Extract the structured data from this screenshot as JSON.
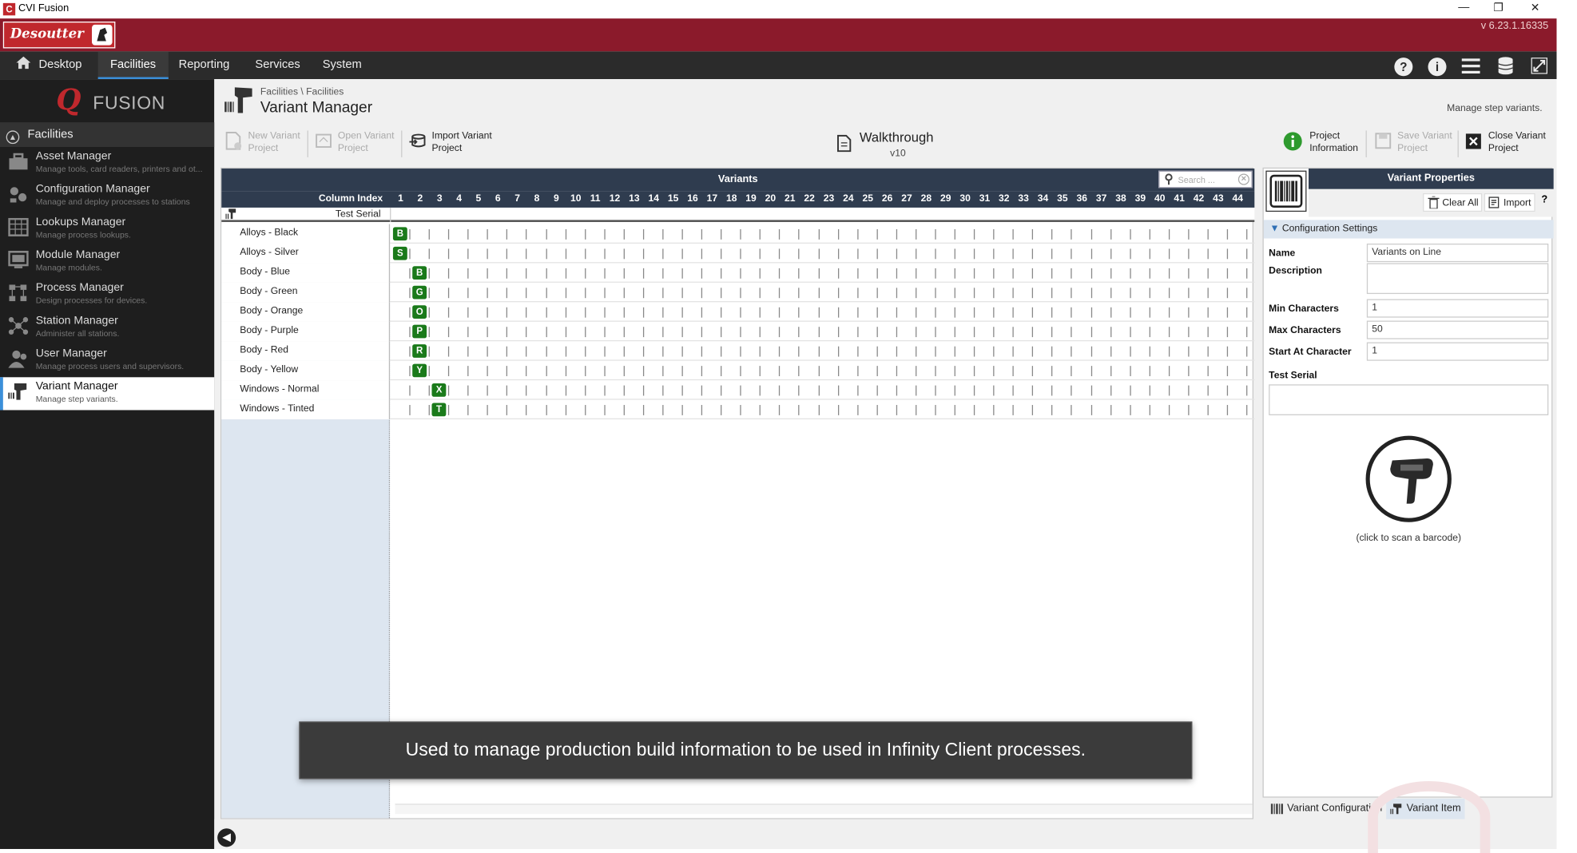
{
  "window": {
    "title": "CVI Fusion",
    "controls": [
      "—",
      "❐",
      "✕"
    ]
  },
  "brand": {
    "logo_text": "Desoutter",
    "version": "v 6.23.1.16335"
  },
  "menu": {
    "items": [
      "Desktop",
      "Facilities",
      "Reporting",
      "Services",
      "System"
    ],
    "active": "Facilities"
  },
  "sidebar": {
    "logo_text": "FUSION",
    "section": "Facilities",
    "items": [
      {
        "label": "Asset Manager",
        "sub": "Manage tools, card readers, printers and ot..."
      },
      {
        "label": "Configuration Manager",
        "sub": "Manage and deploy processes to stations"
      },
      {
        "label": "Lookups Manager",
        "sub": "Manage process lookups."
      },
      {
        "label": "Module Manager",
        "sub": "Manage modules."
      },
      {
        "label": "Process Manager",
        "sub": "Design processes for devices."
      },
      {
        "label": "Station Manager",
        "sub": "Administer all stations."
      },
      {
        "label": "User Manager",
        "sub": "Manage process users and supervisors."
      },
      {
        "label": "Variant Manager",
        "sub": "Manage step variants."
      }
    ]
  },
  "header": {
    "breadcrumb": "Facilities \\ Facilities",
    "title": "Variant Manager",
    "description": "Manage step variants."
  },
  "toolbar": {
    "new_l1": "New Variant",
    "new_l2": "Project",
    "open_l1": "Open Variant",
    "open_l2": "Project",
    "import_l1": "Import Variant",
    "import_l2": "Project",
    "walk_name": "Walkthrough",
    "walk_version": "v10",
    "info_l1": "Project",
    "info_l2": "Information",
    "save_l1": "Save Variant",
    "save_l2": "Project",
    "close_l1": "Close Variant",
    "close_l2": "Project"
  },
  "grid": {
    "title": "Variants",
    "search_placeholder": "Search ...",
    "column_index_label": "Column Index",
    "test_serial_label": "Test Serial",
    "columns": [
      "1",
      "2",
      "3",
      "4",
      "5",
      "6",
      "7",
      "8",
      "9",
      "10",
      "11",
      "12",
      "13",
      "14",
      "15",
      "16",
      "17",
      "18",
      "19",
      "20",
      "21",
      "22",
      "23",
      "24",
      "25",
      "26",
      "27",
      "28",
      "29",
      "30",
      "31",
      "32",
      "33",
      "34",
      "35",
      "36",
      "37",
      "38",
      "39",
      "40",
      "41",
      "42",
      "43",
      "44"
    ],
    "rows": [
      {
        "name": "Alloys - Black",
        "col": 1,
        "tag": "B"
      },
      {
        "name": "Alloys - Silver",
        "col": 1,
        "tag": "S"
      },
      {
        "name": "Body - Blue",
        "col": 2,
        "tag": "B"
      },
      {
        "name": "Body - Green",
        "col": 2,
        "tag": "G"
      },
      {
        "name": "Body - Orange",
        "col": 2,
        "tag": "O"
      },
      {
        "name": "Body - Purple",
        "col": 2,
        "tag": "P"
      },
      {
        "name": "Body - Red",
        "col": 2,
        "tag": "R"
      },
      {
        "name": "Body - Yellow",
        "col": 2,
        "tag": "Y"
      },
      {
        "name": "Windows - Normal",
        "col": 3,
        "tag": "X"
      },
      {
        "name": "Windows - Tinted",
        "col": 3,
        "tag": "T"
      }
    ]
  },
  "overlay": {
    "text": "Used to manage production build information to be used in Infinity Client processes."
  },
  "properties": {
    "title": "Variant Properties",
    "clear_all": "Clear All",
    "import": "Import",
    "help": "?",
    "config_section": "Configuration Settings",
    "name_label": "Name",
    "name_value": "Variants on Line",
    "description_label": "Description",
    "description_value": "",
    "min_label": "Min Characters",
    "min_value": "1",
    "max_label": "Max Characters",
    "max_value": "50",
    "start_label": "Start At Character",
    "start_value": "1",
    "test_serial_label": "Test Serial",
    "test_serial_value": "",
    "scan_hint": "(click to scan a barcode)"
  },
  "bottom_tabs": {
    "config": "Variant Configuration",
    "item": "Variant Item"
  },
  "colors": {
    "brand": "#8b1a2b",
    "menubar": "#2b2b2b",
    "sidebar": "#1e1e1e",
    "grid_header": "#2f3c4f",
    "tag": "#1a7a1a",
    "accent": "#3b8fd9"
  }
}
